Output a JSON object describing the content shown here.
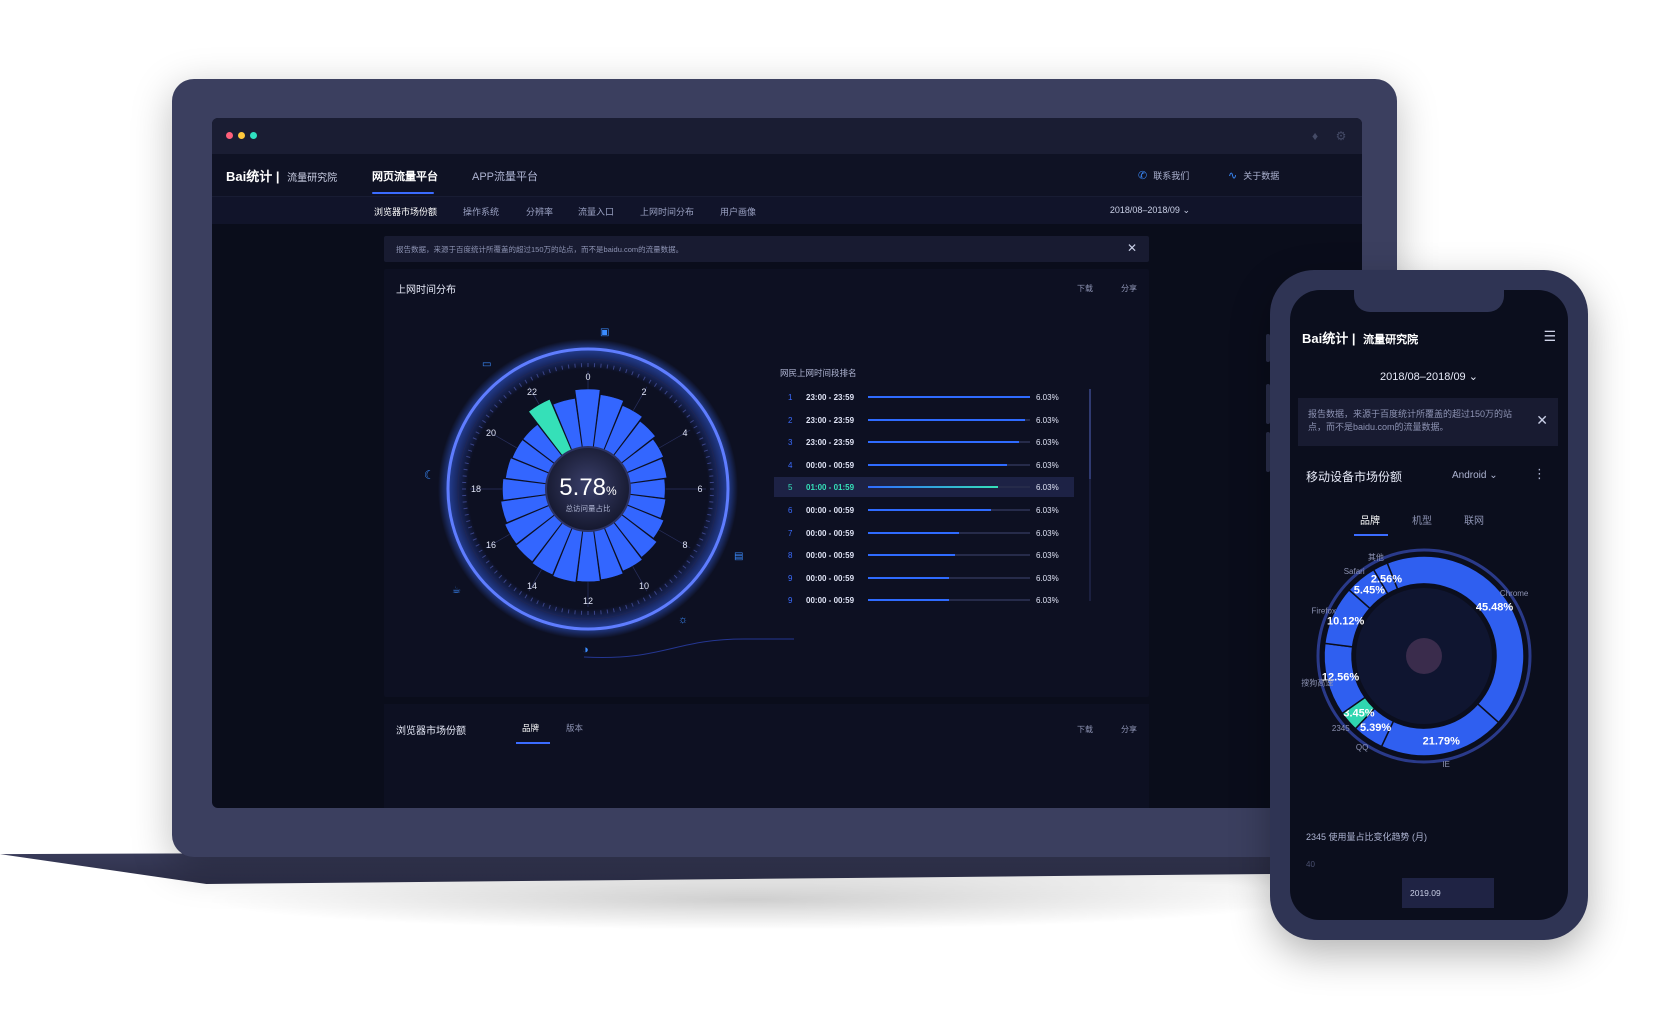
{
  "desktop": {
    "logo": {
      "brand": "Bai统计",
      "sub": "流量研究院"
    },
    "top_tabs": [
      "网页流量平台",
      "APP流量平台"
    ],
    "top_links": {
      "contact": "联系我们",
      "about": "关于数据"
    },
    "sub_tabs": [
      "浏览器市场份额",
      "操作系统",
      "分辨率",
      "流量入口",
      "上网时间分布",
      "用户画像"
    ],
    "date_range": "2018/08–2018/09",
    "notice": "报告数据，来源于百度统计所覆盖的超过150万的站点，而不是baidu.com的流量数据。",
    "panel_time": {
      "title": "上网时间分布",
      "download": "下载",
      "share": "分享",
      "center_value": "5.78",
      "center_unit": "%",
      "center_label": "总访问量占比",
      "hour_labels": [
        "0",
        "2",
        "4",
        "6",
        "8",
        "10",
        "12",
        "14",
        "16",
        "18",
        "20",
        "22"
      ],
      "ranking_title": "网民上网时间段排名",
      "ranking": [
        {
          "rank": "1",
          "time": "23:00 - 23:59",
          "pct": "6.03%",
          "fill": 1.0
        },
        {
          "rank": "2",
          "time": "23:00 - 23:59",
          "pct": "6.03%",
          "fill": 0.97
        },
        {
          "rank": "3",
          "time": "23:00 - 23:59",
          "pct": "6.03%",
          "fill": 0.93
        },
        {
          "rank": "4",
          "time": "00:00 - 00:59",
          "pct": "6.03%",
          "fill": 0.86
        },
        {
          "rank": "5",
          "time": "01:00 - 01:59",
          "pct": "6.03%",
          "fill": 0.8
        },
        {
          "rank": "6",
          "time": "00:00 - 00:59",
          "pct": "6.03%",
          "fill": 0.76
        },
        {
          "rank": "7",
          "time": "00:00 - 00:59",
          "pct": "6.03%",
          "fill": 0.56
        },
        {
          "rank": "8",
          "time": "00:00 - 00:59",
          "pct": "6.03%",
          "fill": 0.54
        },
        {
          "rank": "9",
          "time": "00:00 - 00:59",
          "pct": "6.03%",
          "fill": 0.5
        },
        {
          "rank": "9",
          "time": "00:00 - 00:59",
          "pct": "6.03%",
          "fill": 0.5
        }
      ],
      "highlight_rank_index": 4
    },
    "panel_browser": {
      "title": "浏览器市场份额",
      "tabs": [
        "品牌",
        "版本"
      ],
      "download": "下载",
      "share": "分享"
    },
    "colors": {
      "accent": "#3b6cff",
      "highlight": "#35e0b8",
      "bg": "#0a0d1b"
    }
  },
  "mobile": {
    "logo": {
      "brand": "Bai统计",
      "sub": "流量研究院"
    },
    "date_range": "2018/08–2018/09",
    "notice": "报告数据，来源于百度统计所覆盖的超过150万的站点，而不是baidu.com的流量数据。",
    "card_title": "移动设备市场份额",
    "platform": "Android",
    "tabs": [
      "品牌",
      "机型",
      "联网"
    ],
    "trend_title": "2345 使用量占比变化趋势 (月)",
    "axis_top": "40",
    "tooltip_date": "2019.09"
  },
  "chart_data": [
    {
      "type": "bar",
      "chart": "polar hour distribution (24 radial bars, clock face)",
      "categories": [
        "0",
        "1",
        "2",
        "3",
        "4",
        "5",
        "6",
        "7",
        "8",
        "9",
        "10",
        "11",
        "12",
        "13",
        "14",
        "15",
        "16",
        "17",
        "18",
        "19",
        "20",
        "21",
        "22",
        "23"
      ],
      "values": [
        100,
        92,
        84,
        76,
        70,
        66,
        62,
        64,
        70,
        78,
        82,
        86,
        88,
        90,
        88,
        86,
        84,
        80,
        76,
        72,
        70,
        70,
        96,
        86
      ],
      "highlight_category": "22",
      "center_value": "5.78%"
    },
    {
      "type": "pie",
      "labels": [
        "Chrome",
        "IE",
        "QQ",
        "2345",
        "搜狗高速",
        "Firefox",
        "Safari",
        "其他"
      ],
      "values": [
        45.48,
        21.79,
        5.39,
        3.45,
        12.56,
        10.12,
        5.45,
        2.56
      ],
      "value_labels": [
        "45.48%",
        "21.79%",
        "5.39%",
        "3.45%",
        "12.56%",
        "10.12%",
        "5.45%",
        "2.56%"
      ],
      "highlight": "2345"
    }
  ]
}
